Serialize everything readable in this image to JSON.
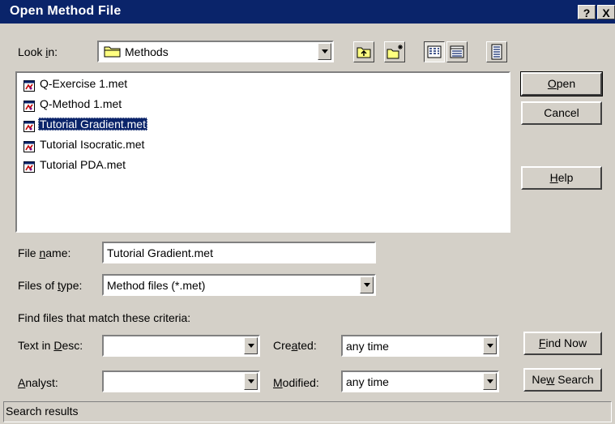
{
  "window": {
    "title": "Open Method File",
    "help_btn": "?",
    "close_btn": "X"
  },
  "look_in": {
    "label_pre": "Look ",
    "label_ul": "i",
    "label_post": "n:",
    "value": "Methods"
  },
  "files": [
    {
      "name": "Q-Exercise 1.met",
      "selected": false
    },
    {
      "name": "Q-Method 1.met",
      "selected": false
    },
    {
      "name": "Tutorial Gradient.met",
      "selected": true
    },
    {
      "name": "Tutorial Isocratic.met",
      "selected": false
    },
    {
      "name": "Tutorial PDA.met",
      "selected": false
    }
  ],
  "buttons": {
    "open": {
      "ul": "O",
      "rest": "pen"
    },
    "cancel": "Cancel",
    "help": {
      "ul": "H",
      "rest": "elp"
    },
    "find_now": {
      "ul": "F",
      "rest": "ind Now"
    },
    "new_search": {
      "pre": "Ne",
      "ul": "w",
      "rest": " Search"
    }
  },
  "file_name": {
    "label_pre": "File ",
    "label_ul": "n",
    "label_post": "ame:",
    "value": "Tutorial Gradient.met"
  },
  "file_type": {
    "label_pre": "Files of ",
    "label_ul": "t",
    "label_post": "ype:",
    "value": "Method files (*.met)"
  },
  "criteria": {
    "heading": "Find files that match these criteria:",
    "text_in_desc": {
      "pre": "Text in ",
      "ul": "D",
      "post": "esc:",
      "value": ""
    },
    "analyst": {
      "pre": "",
      "ul": "A",
      "post": "nalyst:",
      "value": ""
    },
    "created": {
      "pre": "Cre",
      "ul": "a",
      "post": "ted:",
      "value": "any time"
    },
    "modified": {
      "pre": "",
      "ul": "M",
      "post": "odified:",
      "value": "any time"
    }
  },
  "status_bar": "Search results",
  "colors": {
    "titlebar": "#0a246a",
    "face": "#d4d0c8",
    "selection": "#0a246a"
  }
}
